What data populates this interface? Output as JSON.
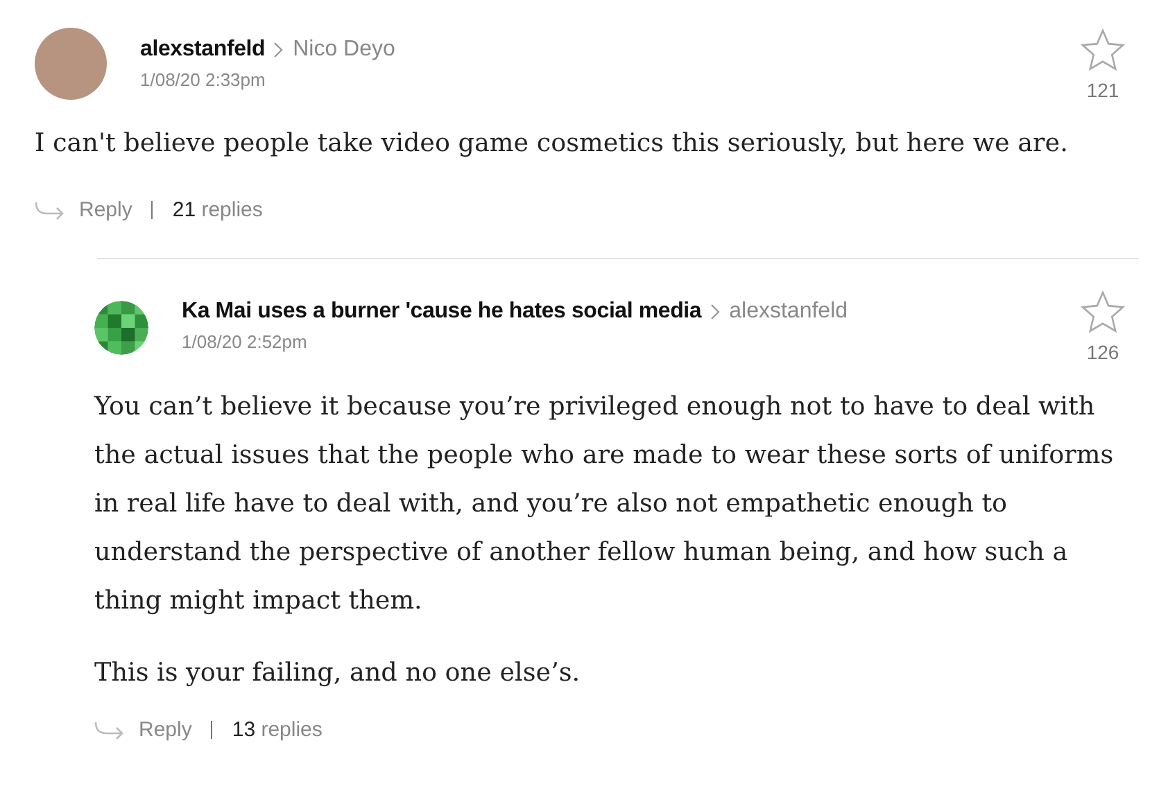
{
  "comments": [
    {
      "kind": "photo",
      "author": "alexstanfeld",
      "reply_to": "Nico Deyo",
      "time": "1/08/20 2:33pm",
      "likes": "121",
      "starred": false,
      "body": [
        "I can't believe people take video game cosmetics this seriously, but here we are."
      ],
      "reply_label": "Reply",
      "replies_count": "21",
      "replies_label": "replies",
      "nested": false
    },
    {
      "kind": "pixel",
      "author": "Ka Mai uses a burner 'cause he hates social media",
      "reply_to": "alexstanfeld",
      "time": "1/08/20 2:52pm",
      "likes": "126",
      "starred": false,
      "body": [
        "You can’t believe it because you’re privileged enough not to have to deal with the actual issues that the people who are made to wear these sorts of uniforms in real life have to deal with, and you’re also not empathetic enough to understand the perspective of another fellow human being, and how such a thing might impact them.",
        "This is your failing, and no one else’s."
      ],
      "reply_label": "Reply",
      "replies_count": "13",
      "replies_label": "replies",
      "nested": true
    }
  ]
}
